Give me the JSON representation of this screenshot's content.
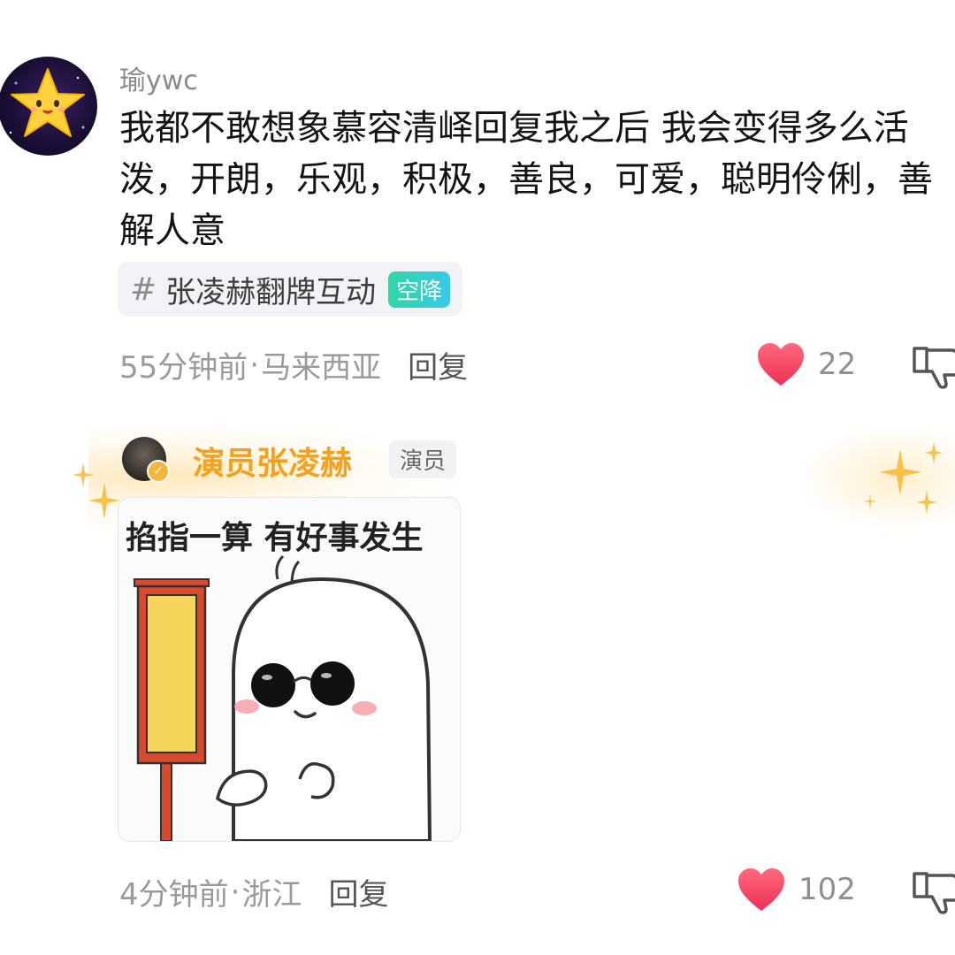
{
  "comments": [
    {
      "username": "瑜ywc",
      "avatar_icon": "star-face-icon",
      "text": "我都不敢想象慕容清峄回复我之后 我会变得多么活泼，开朗，乐观，积极，善良，可爱，聪明伶俐，善解人意",
      "topic": {
        "hash": "#",
        "label": "张凌赫翻牌互动",
        "badge": "空降"
      },
      "time": "55分钟前",
      "sep": "·",
      "location": "马来西亚",
      "reply_label": "回复",
      "likes": "22"
    },
    {
      "username": "演员张凌赫",
      "role_badge": "演员",
      "sticker_caption": "掐指一算 有好事发生",
      "time": "4分钟前",
      "sep": "·",
      "location": "浙江",
      "reply_label": "回复",
      "likes": "102"
    }
  ],
  "colors": {
    "like": "#f24766",
    "verified_name": "#f3a11f",
    "topic_badge": "#2fd6a3"
  }
}
